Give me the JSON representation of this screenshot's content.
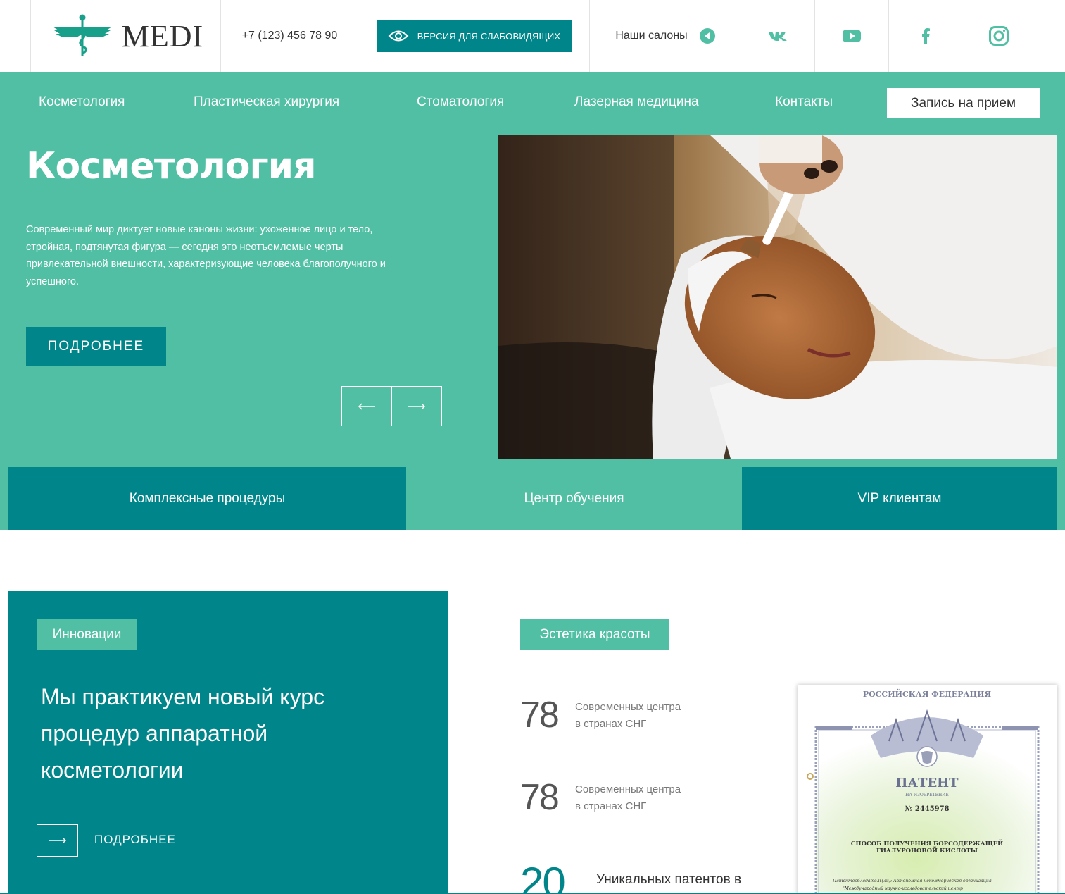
{
  "header": {
    "logo_text": "MEDI",
    "phone": "+7 (123) 456 78 90",
    "vision_button": "ВЕРСИЯ ДЛЯ СЛАБОВИДЯЩИХ",
    "salons": "Наши салоны",
    "social": [
      "vk-icon",
      "youtube-icon",
      "facebook-icon",
      "instagram-icon"
    ]
  },
  "nav": {
    "items": [
      "Косметология",
      "Пластическая хирургия",
      "Стоматология",
      "Лазерная медицина",
      "Контакты"
    ],
    "book_button": "Запись на прием"
  },
  "hero": {
    "title": "Косметология",
    "text": "Современный мир диктует новые каноны жизни: ухоженное лицо и тело, стройная, подтянутая фигура — сегодня это неотъемлемые черты привлекательной внешности, характеризующие человека благополучного и успешного.",
    "more_button": "ПОДРОБНЕЕ"
  },
  "tabs": [
    "Комплексные процедуры",
    "Центр обучения",
    "VIP клиентам"
  ],
  "innovations": {
    "tag": "Инновации",
    "title": "Мы практикуем новый курс процедур аппаратной косметологии",
    "more": "ПОДРОБНЕЕ"
  },
  "aesthetics": {
    "tag": "Эстетика красоты",
    "stats": [
      {
        "value": "78",
        "label_line1": "Современных центра",
        "label_line2": "в странах СНГ"
      },
      {
        "value": "78",
        "label_line1": "Современных центра",
        "label_line2": "в странах СНГ"
      },
      {
        "value": "20",
        "label_line1": "Уникальных патентов в"
      }
    ]
  },
  "patent": {
    "header": "РОССИЙСКАЯ ФЕДЕРАЦИЯ",
    "title": "ПАТЕНТ",
    "subtitle": "НА ИЗОБРЕТЕНИЕ",
    "number": "№ 2445978",
    "invention_line1": "СПОСОБ ПОЛУЧЕНИЯ БОРСОДЕРЖАЩЕЙ",
    "invention_line2": "ГИАЛУРОНОВОЙ КИСЛОТЫ",
    "holder_line1": "Патентообладатель(ли): Автономная некоммерческая организация",
    "holder_line2": "\"Международный научно-исследовательский центр"
  },
  "colors": {
    "teal": "#51bfa4",
    "dark_teal": "#00868a"
  }
}
